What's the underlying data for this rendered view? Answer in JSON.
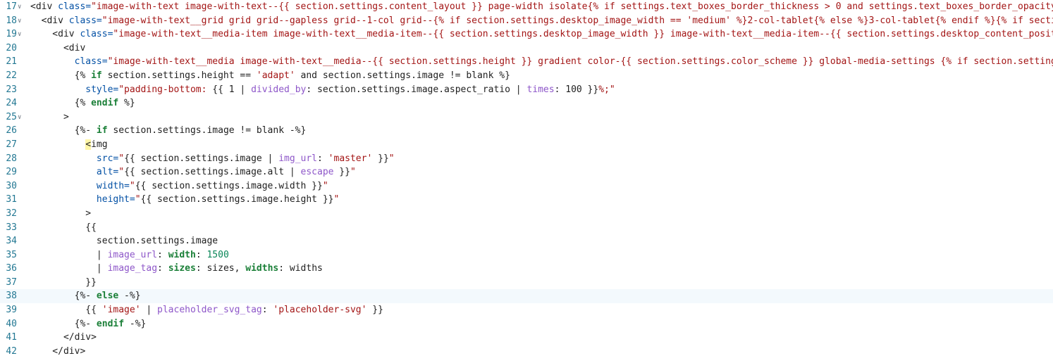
{
  "editor": {
    "lines": [
      {
        "n": "17",
        "fold": true,
        "active": false,
        "tokens": [
          {
            "t": "<div ",
            "c": "tag"
          },
          {
            "t": "class=",
            "c": "attr"
          },
          {
            "t": "\"image-with-text image-with-text--{{ section.settings.content_layout }} page-width isolate{% if settings.text_boxes_border_thickness > 0 and settings.text_boxes_border_opacity > ",
            "c": "str"
          }
        ]
      },
      {
        "n": "18",
        "fold": true,
        "active": false,
        "tokens": [
          {
            "t": "  <div ",
            "c": "tag"
          },
          {
            "t": "class=",
            "c": "attr"
          },
          {
            "t": "\"image-with-text__grid grid grid--gapless grid--1-col grid--{% if section.settings.desktop_image_width == 'medium' %}2-col-tablet{% else %}3-col-tablet{% endif %}{% if section.",
            "c": "str"
          }
        ]
      },
      {
        "n": "19",
        "fold": true,
        "active": false,
        "tokens": [
          {
            "t": "    <div ",
            "c": "tag"
          },
          {
            "t": "class=",
            "c": "attr"
          },
          {
            "t": "\"image-with-text__media-item image-with-text__media-item--{{ section.settings.desktop_image_width }} image-with-text__media-item--{{ section.settings.desktop_content_position",
            "c": "str"
          }
        ]
      },
      {
        "n": "20",
        "fold": false,
        "active": false,
        "tokens": [
          {
            "t": "      <div",
            "c": "tag"
          }
        ]
      },
      {
        "n": "21",
        "fold": false,
        "active": false,
        "tokens": [
          {
            "t": "        ",
            "c": "tag"
          },
          {
            "t": "class=",
            "c": "attr"
          },
          {
            "t": "\"image-with-text__media image-with-text__media--{{ section.settings.height }} gradient color-{{ section.settings.color_scheme }} global-media-settings {% if section.settings.i",
            "c": "str"
          }
        ]
      },
      {
        "n": "22",
        "fold": false,
        "active": false,
        "tokens": [
          {
            "t": "        {% ",
            "c": "liquid"
          },
          {
            "t": "if",
            "c": "kw2"
          },
          {
            "t": " section.settings.height == ",
            "c": "liquid"
          },
          {
            "t": "'adapt'",
            "c": "str"
          },
          {
            "t": " and section.settings.image != blank %}",
            "c": "liquid"
          }
        ]
      },
      {
        "n": "23",
        "fold": false,
        "active": false,
        "tokens": [
          {
            "t": "          style=",
            "c": "attr"
          },
          {
            "t": "\"padding-bottom: ",
            "c": "str"
          },
          {
            "t": "{{ 1 | ",
            "c": "liquid"
          },
          {
            "t": "divided_by",
            "c": "filter"
          },
          {
            "t": ": section.settings.image.aspect_ratio | ",
            "c": "liquid"
          },
          {
            "t": "times",
            "c": "filter"
          },
          {
            "t": ": 100 }}",
            "c": "liquid"
          },
          {
            "t": "%;\"",
            "c": "str"
          }
        ]
      },
      {
        "n": "24",
        "fold": false,
        "active": false,
        "tokens": [
          {
            "t": "        {% ",
            "c": "liquid"
          },
          {
            "t": "endif",
            "c": "kw2"
          },
          {
            "t": " %}",
            "c": "liquid"
          }
        ]
      },
      {
        "n": "25",
        "fold": true,
        "active": false,
        "tokens": [
          {
            "t": "      >",
            "c": "tag"
          }
        ]
      },
      {
        "n": "26",
        "fold": false,
        "active": false,
        "tokens": [
          {
            "t": "        {%- ",
            "c": "liquid"
          },
          {
            "t": "if",
            "c": "kw2"
          },
          {
            "t": " section.settings.image != blank -%}",
            "c": "liquid"
          }
        ]
      },
      {
        "n": "27",
        "fold": false,
        "active": false,
        "tokens": [
          {
            "t": "          ",
            "c": "tag"
          },
          {
            "t": "<",
            "c": "bracket"
          },
          {
            "t": "img",
            "c": "tag"
          }
        ]
      },
      {
        "n": "28",
        "fold": false,
        "active": false,
        "tokens": [
          {
            "t": "            src=",
            "c": "attr"
          },
          {
            "t": "\"",
            "c": "str"
          },
          {
            "t": "{{ section.settings.image | ",
            "c": "liquid"
          },
          {
            "t": "img_url",
            "c": "filter"
          },
          {
            "t": ": ",
            "c": "liquid"
          },
          {
            "t": "'master'",
            "c": "str"
          },
          {
            "t": " }}",
            "c": "liquid"
          },
          {
            "t": "\"",
            "c": "str"
          }
        ]
      },
      {
        "n": "29",
        "fold": false,
        "active": false,
        "tokens": [
          {
            "t": "            alt=",
            "c": "attr"
          },
          {
            "t": "\"",
            "c": "str"
          },
          {
            "t": "{{ section.settings.image.alt | ",
            "c": "liquid"
          },
          {
            "t": "escape",
            "c": "filter"
          },
          {
            "t": " }}",
            "c": "liquid"
          },
          {
            "t": "\"",
            "c": "str"
          }
        ]
      },
      {
        "n": "30",
        "fold": false,
        "active": false,
        "tokens": [
          {
            "t": "            width=",
            "c": "attr"
          },
          {
            "t": "\"",
            "c": "str"
          },
          {
            "t": "{{ section.settings.image.width }}",
            "c": "liquid"
          },
          {
            "t": "\"",
            "c": "str"
          }
        ]
      },
      {
        "n": "31",
        "fold": false,
        "active": false,
        "tokens": [
          {
            "t": "            height=",
            "c": "attr"
          },
          {
            "t": "\"",
            "c": "str"
          },
          {
            "t": "{{ section.settings.image.height }}",
            "c": "liquid"
          },
          {
            "t": "\"",
            "c": "str"
          }
        ]
      },
      {
        "n": "32",
        "fold": false,
        "active": false,
        "tokens": [
          {
            "t": "          >",
            "c": "tag"
          }
        ]
      },
      {
        "n": "33",
        "fold": false,
        "active": false,
        "tokens": [
          {
            "t": "          {{",
            "c": "liquid"
          }
        ]
      },
      {
        "n": "34",
        "fold": false,
        "active": false,
        "tokens": [
          {
            "t": "            section.settings.image",
            "c": "liquid"
          }
        ]
      },
      {
        "n": "35",
        "fold": false,
        "active": false,
        "tokens": [
          {
            "t": "            | ",
            "c": "liquid"
          },
          {
            "t": "image_url",
            "c": "filter"
          },
          {
            "t": ": ",
            "c": "liquid"
          },
          {
            "t": "width",
            "c": "kw2"
          },
          {
            "t": ": ",
            "c": "liquid"
          },
          {
            "t": "1500",
            "c": "num"
          }
        ]
      },
      {
        "n": "36",
        "fold": false,
        "active": false,
        "tokens": [
          {
            "t": "            | ",
            "c": "liquid"
          },
          {
            "t": "image_tag",
            "c": "filter"
          },
          {
            "t": ": ",
            "c": "liquid"
          },
          {
            "t": "sizes",
            "c": "kw2"
          },
          {
            "t": ": sizes, ",
            "c": "liquid"
          },
          {
            "t": "widths",
            "c": "kw2"
          },
          {
            "t": ": widths",
            "c": "liquid"
          }
        ]
      },
      {
        "n": "37",
        "fold": false,
        "active": false,
        "tokens": [
          {
            "t": "          }}",
            "c": "liquid"
          }
        ]
      },
      {
        "n": "38",
        "fold": false,
        "active": true,
        "tokens": [
          {
            "t": "        {%- ",
            "c": "liquid"
          },
          {
            "t": "else",
            "c": "kw2"
          },
          {
            "t": " -%}",
            "c": "liquid"
          }
        ]
      },
      {
        "n": "39",
        "fold": false,
        "active": false,
        "tokens": [
          {
            "t": "          {{ ",
            "c": "liquid"
          },
          {
            "t": "'image'",
            "c": "str"
          },
          {
            "t": " | ",
            "c": "liquid"
          },
          {
            "t": "placeholder_svg_tag",
            "c": "filter"
          },
          {
            "t": ": ",
            "c": "liquid"
          },
          {
            "t": "'placeholder-svg'",
            "c": "str"
          },
          {
            "t": " }}",
            "c": "liquid"
          }
        ]
      },
      {
        "n": "40",
        "fold": false,
        "active": false,
        "tokens": [
          {
            "t": "        {%- ",
            "c": "liquid"
          },
          {
            "t": "endif",
            "c": "kw2"
          },
          {
            "t": " -%}",
            "c": "liquid"
          }
        ]
      },
      {
        "n": "41",
        "fold": false,
        "active": false,
        "tokens": [
          {
            "t": "      </div>",
            "c": "tag"
          }
        ]
      },
      {
        "n": "42",
        "fold": false,
        "active": false,
        "tokens": [
          {
            "t": "    </div>",
            "c": "tag"
          }
        ]
      }
    ],
    "fold_icon": "chevron-down-icon",
    "colors": {
      "line_number": "#237893",
      "tag": "#1f1f1f",
      "attr": "#0451a5",
      "string": "#a31515",
      "keyword": "#1a7f37",
      "filter": "#8e57c9",
      "number": "#098658",
      "active_line": "#f3f9fd",
      "bracket_highlight": "#fff6a8"
    }
  }
}
